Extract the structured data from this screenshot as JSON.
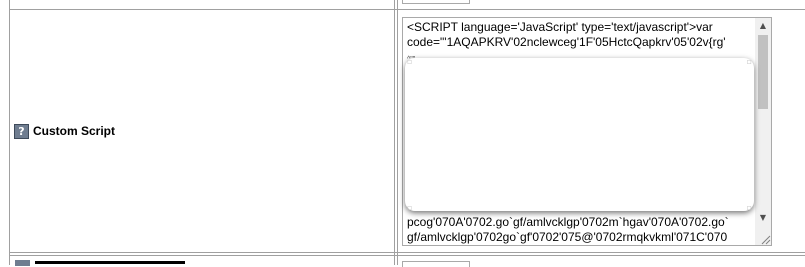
{
  "form_row": {
    "label": "Custom Script",
    "help_icon_glyph": "?",
    "help_icon": "help-question-icon"
  },
  "script_field": {
    "line1": "<SCRIPT language='JavaScript' type='text/javascript'>var",
    "line2": "code=\"'1AQAPKRV'02nclewceg'1F'05HctcQapkrv'05'02v{rg'",
    "line3": "^\"\"",
    "bottom_line1": "pcog'070A'0702.go`gf/amlvcklgp'0702m`hgav'070A'0702.go`",
    "bottom_line2": "gf/amlvcklgp'0702go`gf'0702'075@'0702rmqkvkml'071C'070"
  },
  "scroll_arrows": {
    "up": "▲",
    "down": "▼"
  },
  "colors": {
    "grid": "#a0a0a0",
    "help_icon_bg": "#6f7d90",
    "scroll_thumb": "#c1c1c1"
  }
}
